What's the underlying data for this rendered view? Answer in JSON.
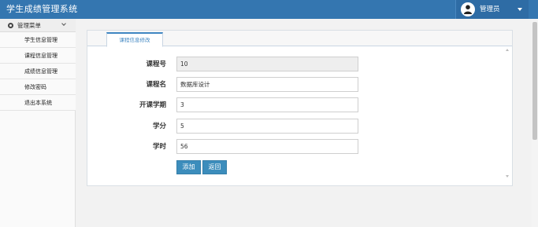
{
  "header": {
    "app_title": "学生成绩管理系统",
    "user_label": "管理员"
  },
  "sidebar": {
    "menu_title": "管理菜单",
    "items": [
      {
        "label": "学生信息管理"
      },
      {
        "label": "课程信息管理"
      },
      {
        "label": "成绩信息管理"
      },
      {
        "label": "修改密码"
      },
      {
        "label": "退出本系统"
      }
    ]
  },
  "main": {
    "tab_label": "课程信息修改",
    "form": {
      "course_id": {
        "label": "课程号",
        "value": "10"
      },
      "course_name": {
        "label": "课程名",
        "value": "数据库设计"
      },
      "semester": {
        "label": "开课学期",
        "value": "3"
      },
      "credit": {
        "label": "学分",
        "value": "5"
      },
      "hours": {
        "label": "学时",
        "value": "56"
      }
    },
    "buttons": {
      "add": "添加",
      "back": "返回"
    }
  },
  "colors": {
    "header_bg": "#3476b0",
    "accent": "#3c8dbc",
    "tab_accent": "#3f86c2"
  },
  "icons": [
    "user-icon",
    "caret-down-icon",
    "gear-icon",
    "chevron-down-icon"
  ]
}
